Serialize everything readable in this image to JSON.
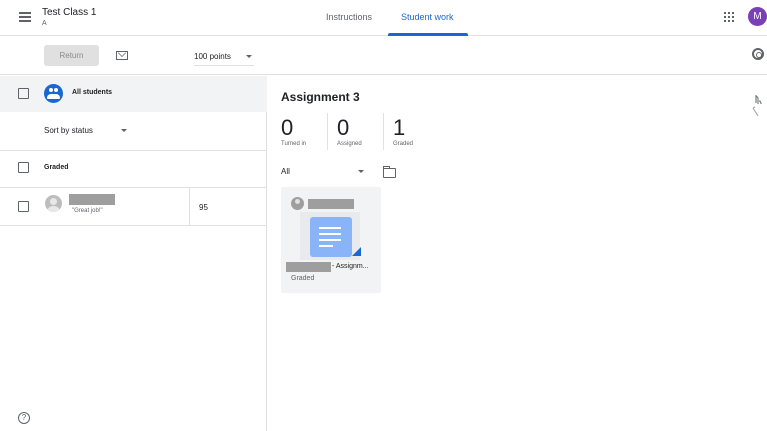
{
  "header": {
    "class_title": "Test Class 1",
    "class_section": "A",
    "tabs": [
      {
        "label": "Instructions",
        "active": false
      },
      {
        "label": "Student work",
        "active": true
      }
    ],
    "avatar_initial": "M",
    "accent_color": "#1967d2",
    "avatar_color": "#7b3fb6"
  },
  "toolbar": {
    "return_label": "Return",
    "points_label": "100 points"
  },
  "left_panel": {
    "all_students_label": "All students",
    "sort_label": "Sort by status",
    "group_label": "Graded",
    "students": [
      {
        "comment": "\"Great job!\"",
        "grade": "95"
      }
    ],
    "help_glyph": "?"
  },
  "right_panel": {
    "assignment_title": "Assignment 3",
    "stats": [
      {
        "count": "0",
        "label": "Turned in"
      },
      {
        "count": "0",
        "label": "Assigned"
      },
      {
        "count": "1",
        "label": "Graded"
      }
    ],
    "filter_label": "All",
    "card": {
      "file_label": "- Assignm...",
      "status": "Graded"
    }
  },
  "icons": [
    "menu-icon",
    "apps-icon",
    "mail-icon",
    "gear-icon",
    "people-icon",
    "folder-icon",
    "document-icon",
    "help-icon"
  ]
}
